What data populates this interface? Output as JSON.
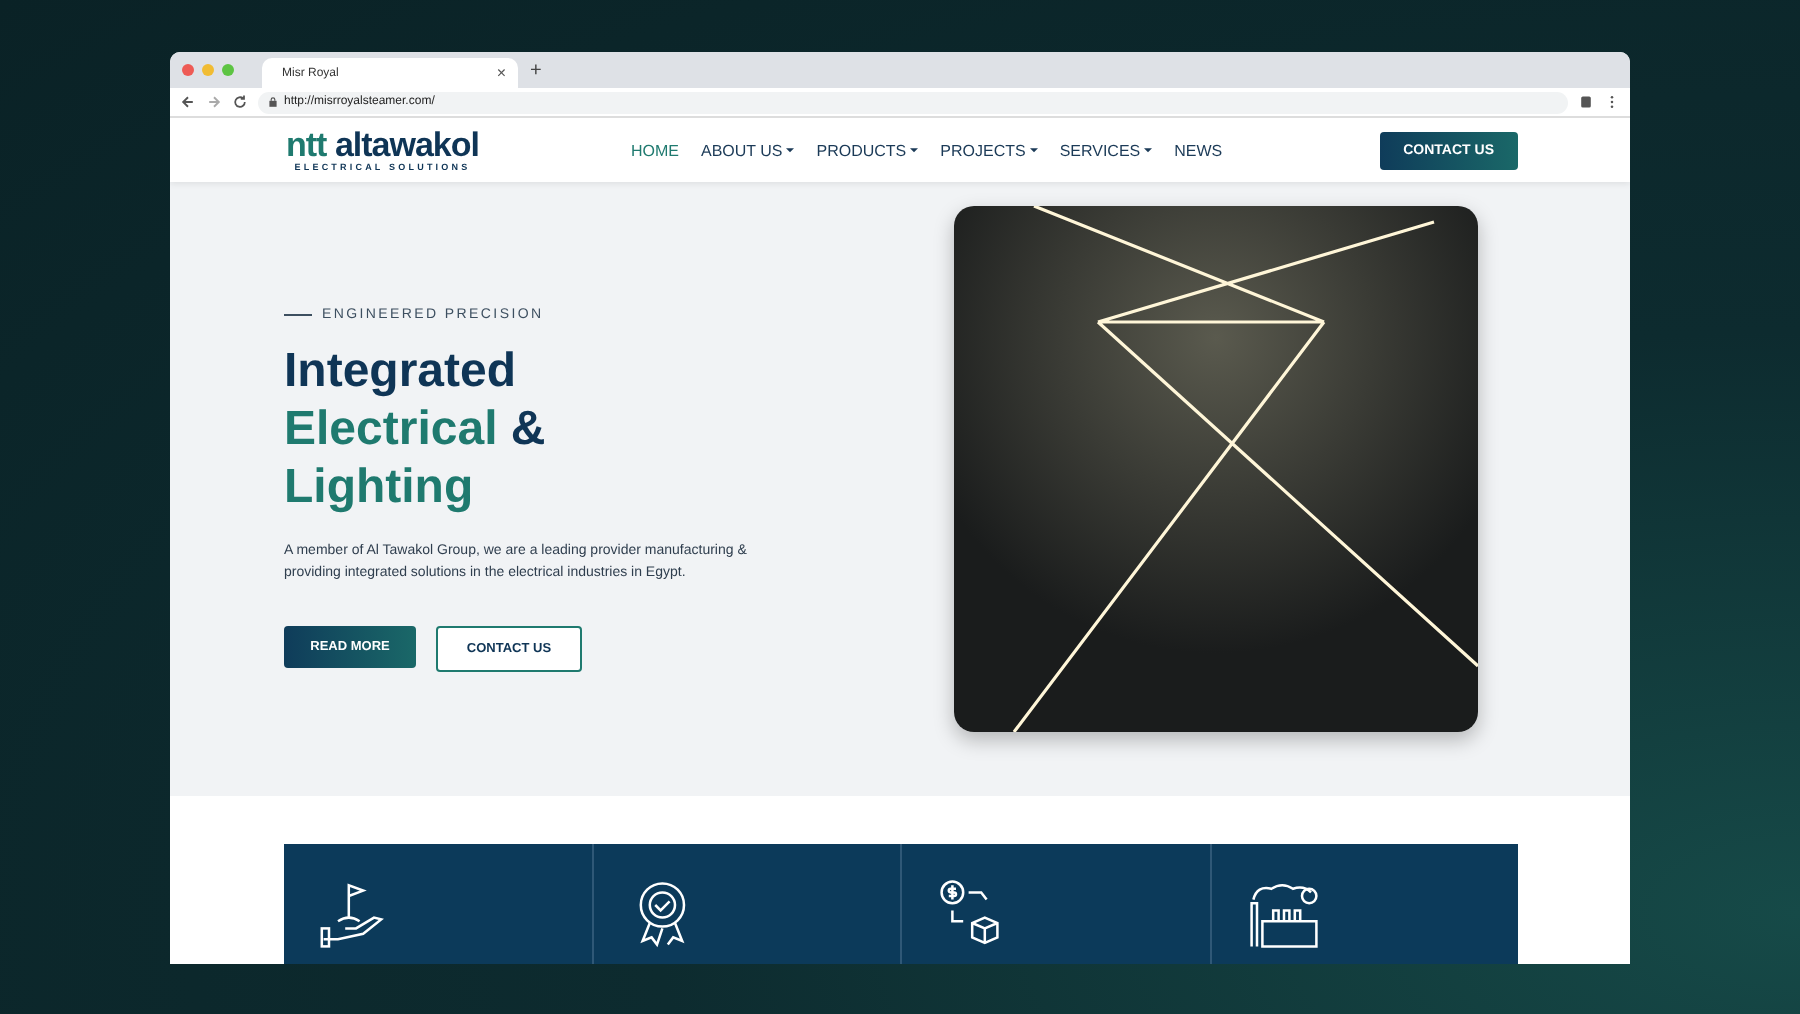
{
  "browser": {
    "tab_title": "Misr Royal",
    "tab_close": "×",
    "new_tab": "+",
    "url": "http://misrroyalsteamer.com/"
  },
  "header": {
    "logo": {
      "brand_left": "ntt",
      "brand_right": "altawakol",
      "tagline": "ELECTRICAL SOLUTIONS"
    },
    "nav": [
      {
        "label": "HOME",
        "selected": true,
        "dropdown": false
      },
      {
        "label": "ABOUT US",
        "selected": false,
        "dropdown": true
      },
      {
        "label": "PRODUCTS",
        "selected": false,
        "dropdown": true
      },
      {
        "label": "PROJECTS",
        "selected": false,
        "dropdown": true
      },
      {
        "label": "SERVICES",
        "selected": false,
        "dropdown": true
      },
      {
        "label": "NEWS",
        "selected": false,
        "dropdown": false
      }
    ],
    "cta": "CONTACT US"
  },
  "hero": {
    "eyebrow": "ENGINEERED PRECISION",
    "title_line1": "Integrated",
    "title_accent": "Electrical",
    "title_amp": "&",
    "title_line3": "Lighting",
    "description": "A member of Al Tawakol Group, we are a leading provider manufacturing & providing integrated solutions in the electrical industries in Egypt.",
    "buttons": [
      {
        "label": "READ MORE",
        "kind": "primary"
      },
      {
        "label": "CONTACT US",
        "kind": "outline"
      }
    ]
  },
  "features": [
    {
      "kind": "flag"
    },
    {
      "kind": "award"
    },
    {
      "kind": "exchange"
    },
    {
      "kind": "factory"
    }
  ]
}
